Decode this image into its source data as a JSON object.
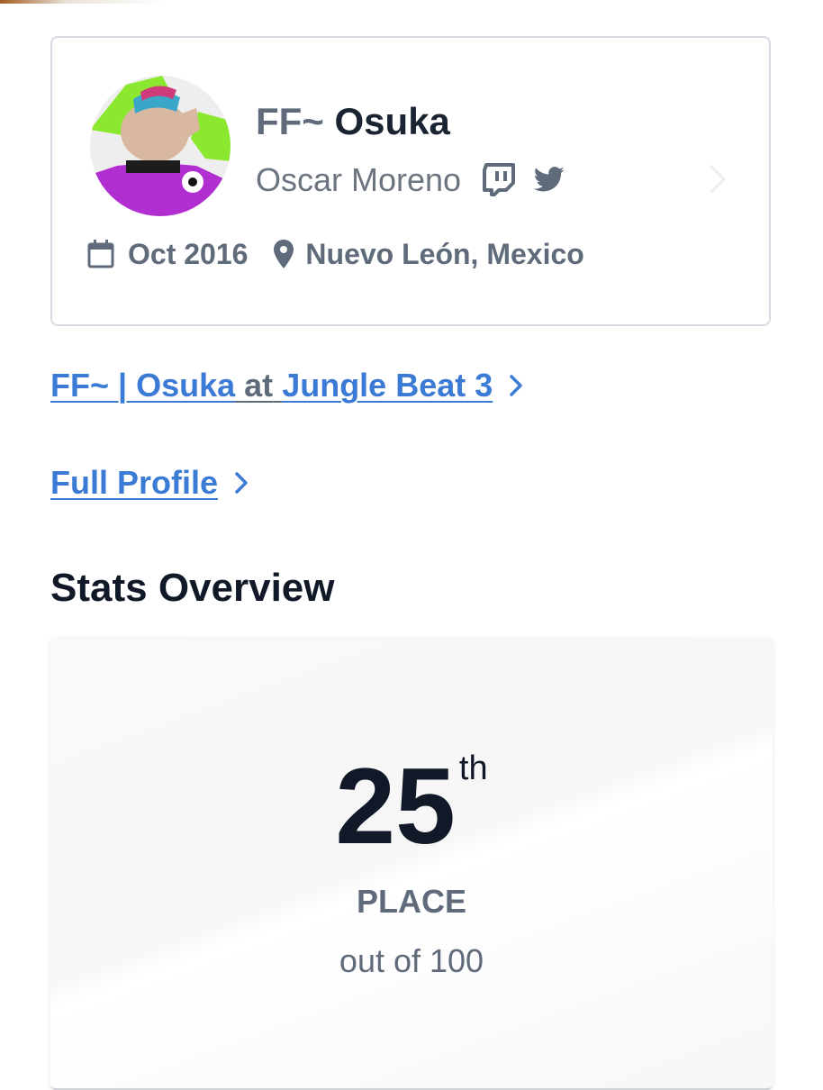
{
  "profile": {
    "gamer_prefix": "FF~",
    "gamer_tag": "Osuka",
    "real_name": "Oscar Moreno",
    "joined": "Oct 2016",
    "location": "Nuevo León, Mexico",
    "socials": [
      "twitch-icon",
      "twitter-icon"
    ]
  },
  "links": {
    "event_entrant": "FF~ | Osuka",
    "event_connector": "at",
    "event_name": "Jungle Beat 3",
    "full_profile": "Full Profile"
  },
  "stats": {
    "section_title": "Stats Overview",
    "placement": "25",
    "placement_suffix": "th",
    "placement_label": "PLACE",
    "out_of": "out of 100"
  },
  "colors": {
    "link": "#3b7bd6",
    "muted": "#5f6b7a",
    "heading": "#111827"
  }
}
